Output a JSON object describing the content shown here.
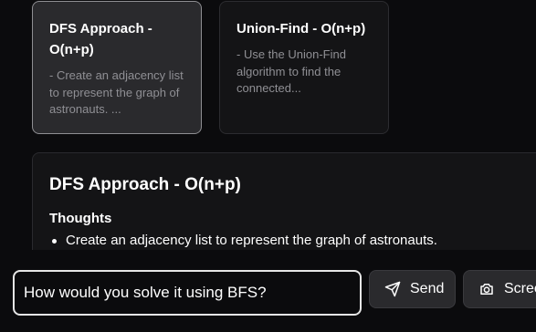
{
  "approaches": [
    {
      "title": "DFS Approach - O(n+p)",
      "description": "- Create an adjacency list to represent the graph of astronauts. ..."
    },
    {
      "title": "Union-Find - O(n+p)",
      "description": "- Use the Union-Find algorithm to find the connected..."
    }
  ],
  "detail": {
    "title": "DFS Approach - O(n+p)",
    "thoughts_heading": "Thoughts",
    "thoughts": [
      "Create an adjacency list to represent the graph of astronauts."
    ]
  },
  "input": {
    "value": "How would you solve it using BFS?",
    "placeholder": ""
  },
  "buttons": {
    "send_label": "Send",
    "screenshot_label": "Scree"
  },
  "icons": {
    "send": "send-icon",
    "screenshot": "camera-icon"
  }
}
